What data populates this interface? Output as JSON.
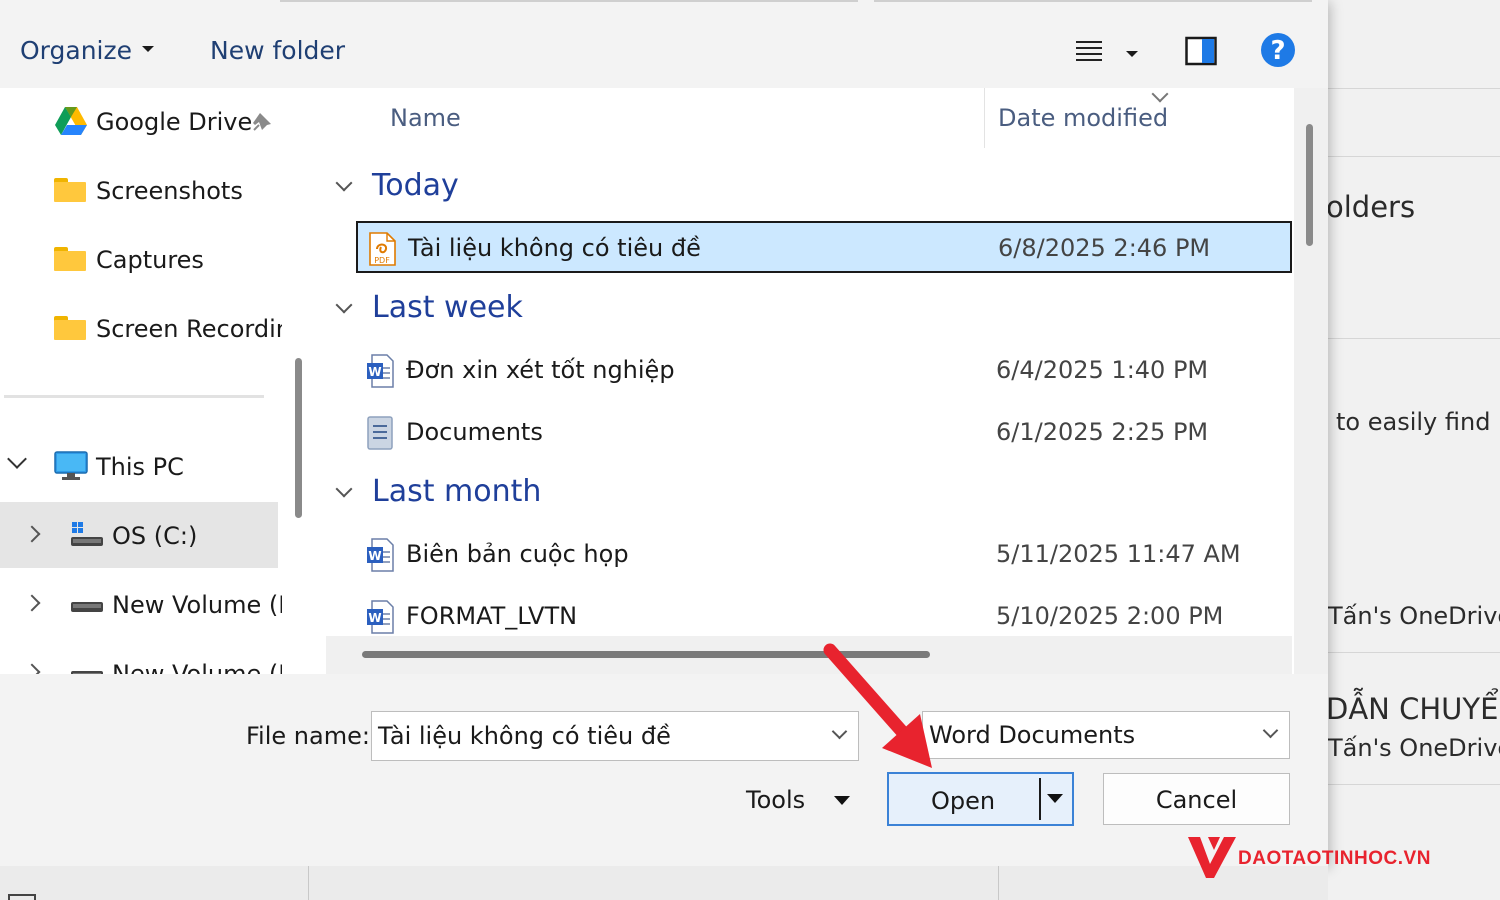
{
  "toolbar": {
    "organize_label": "Organize",
    "new_folder_label": "New folder",
    "help_glyph": "?"
  },
  "nav": {
    "items": [
      {
        "label": "Google Drive",
        "icon": "google-drive-icon"
      },
      {
        "label": "Screenshots",
        "icon": "folder-icon"
      },
      {
        "label": "Captures",
        "icon": "folder-icon"
      },
      {
        "label": "Screen Recordings",
        "icon": "folder-icon"
      }
    ],
    "this_pc": "This PC",
    "drives": [
      {
        "label": "OS (C:)",
        "icon": "system-drive-icon"
      },
      {
        "label": "New Volume (D:)",
        "icon": "drive-icon"
      },
      {
        "label": "New Volume (E:)",
        "icon": "drive-icon"
      }
    ]
  },
  "list": {
    "columns": {
      "name": "Name",
      "date_modified": "Date modified"
    },
    "groups": [
      {
        "header": "Today",
        "files": [
          {
            "name": "Tài liệu không có tiêu đề",
            "date": "6/8/2025 2:46 PM",
            "type": "pdf",
            "selected": true
          }
        ]
      },
      {
        "header": "Last week",
        "files": [
          {
            "name": "Đơn xin xét tốt nghiệp",
            "date": "6/4/2025 1:40 PM",
            "type": "word"
          },
          {
            "name": "Documents",
            "date": "6/1/2025 2:25 PM",
            "type": "document"
          }
        ]
      },
      {
        "header": "Last month",
        "files": [
          {
            "name": "Biên bản cuộc họp",
            "date": "5/11/2025 11:47 AM",
            "type": "word"
          },
          {
            "name": "FORMAT_LVTN",
            "date": "5/10/2025 2:00 PM",
            "type": "word"
          }
        ]
      }
    ]
  },
  "bottom": {
    "file_name_label": "File name:",
    "file_name_value": "Tài liệu không có tiêu đề",
    "file_type_value": "Word Documents",
    "tools_label": "Tools",
    "open_label": "Open",
    "cancel_label": "Cancel"
  },
  "background_app": {
    "texts": [
      "olders",
      "to easily find la",
      "Tấn's OneDrive",
      "DẪN CHUYỂN",
      "Tấn's OneDrive"
    ]
  },
  "watermark": {
    "text": "DAOTAOTINHOC.VN"
  },
  "colors": {
    "accent": "#1f3f9a",
    "selection": "#cce8ff",
    "annotation_arrow": "#e8232e",
    "help": "#1e7ae6"
  }
}
